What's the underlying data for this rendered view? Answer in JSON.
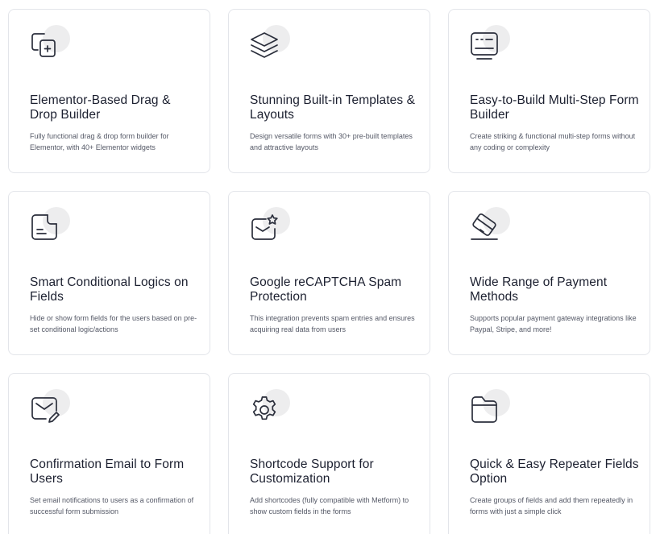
{
  "features": [
    {
      "icon": "drag-drop-icon",
      "title": "Elementor-Based Drag & Drop Builder",
      "description": "Fully functional drag & drop form builder for Elementor, with 40+ Elementor widgets"
    },
    {
      "icon": "layers-icon",
      "title": "Stunning Built-in Templates & Layouts",
      "description": "Design versatile forms with 30+ pre-built templates and attractive layouts"
    },
    {
      "icon": "multistep-form-icon",
      "title": "Easy-to-Build Multi-Step Form Builder",
      "description": "Create striking & functional multi-step forms without any coding or complexity"
    },
    {
      "icon": "document-note-icon",
      "title": "Smart Conditional Logics on Fields",
      "description": "Hide or show form fields for the users based on pre-set conditional logic/actions"
    },
    {
      "icon": "recaptcha-mail-icon",
      "title": "Google reCAPTCHA Spam Protection",
      "description": "This integration prevents spam entries and ensures acquiring real data from users"
    },
    {
      "icon": "credit-card-icon",
      "title": "Wide Range of Payment Methods",
      "description": "Supports popular payment gateway integrations like Paypal, Stripe, and more!"
    },
    {
      "icon": "email-edit-icon",
      "title": "Confirmation Email to Form Users",
      "description": "Set email notifications to users as a confirmation of successful form submission"
    },
    {
      "icon": "gear-icon",
      "title": "Shortcode Support for Customization",
      "description": "Add shortcodes (fully compatible with Metform) to show custom fields in the forms"
    },
    {
      "icon": "folder-icon",
      "title": "Quick & Easy Repeater Fields Option",
      "description": "Create groups of fields and add them repeatedly in forms with just a simple click"
    }
  ]
}
